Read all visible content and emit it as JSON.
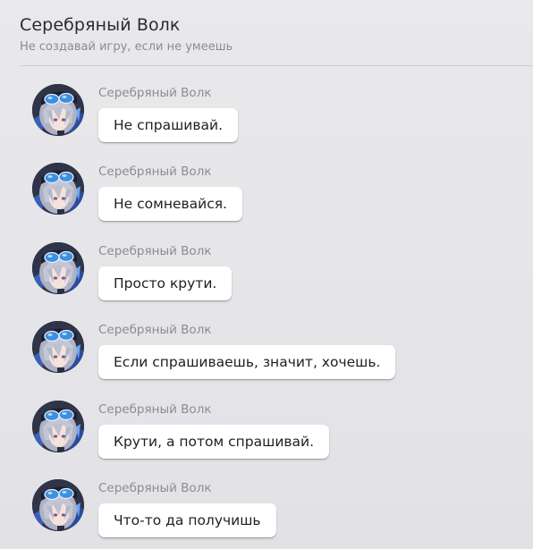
{
  "header": {
    "title": "Серебряный Волк",
    "subtitle": "Не создавай игру, если не умеешь"
  },
  "messages": [
    {
      "sender": "Серебряный Волк",
      "text": "Не спрашивай."
    },
    {
      "sender": "Серебряный Волк",
      "text": "Не сомневайся."
    },
    {
      "sender": "Серебряный Волк",
      "text": "Просто крути."
    },
    {
      "sender": "Серебряный Волк",
      "text": "Если спрашиваешь, значит, хочешь."
    },
    {
      "sender": "Серебряный Волк",
      "text": "Крути, а потом спрашивай."
    },
    {
      "sender": "Серебряный Волк",
      "text": "Что-то да получишь"
    }
  ],
  "colors": {
    "background": "#e6e6ea",
    "bubble": "#ffffff",
    "sender_text": "#8b8b93",
    "avatar_hair": "#b9bccb",
    "avatar_goggles": "#3d8fe0"
  },
  "icons": {
    "avatar": "anime-character-avatar"
  }
}
